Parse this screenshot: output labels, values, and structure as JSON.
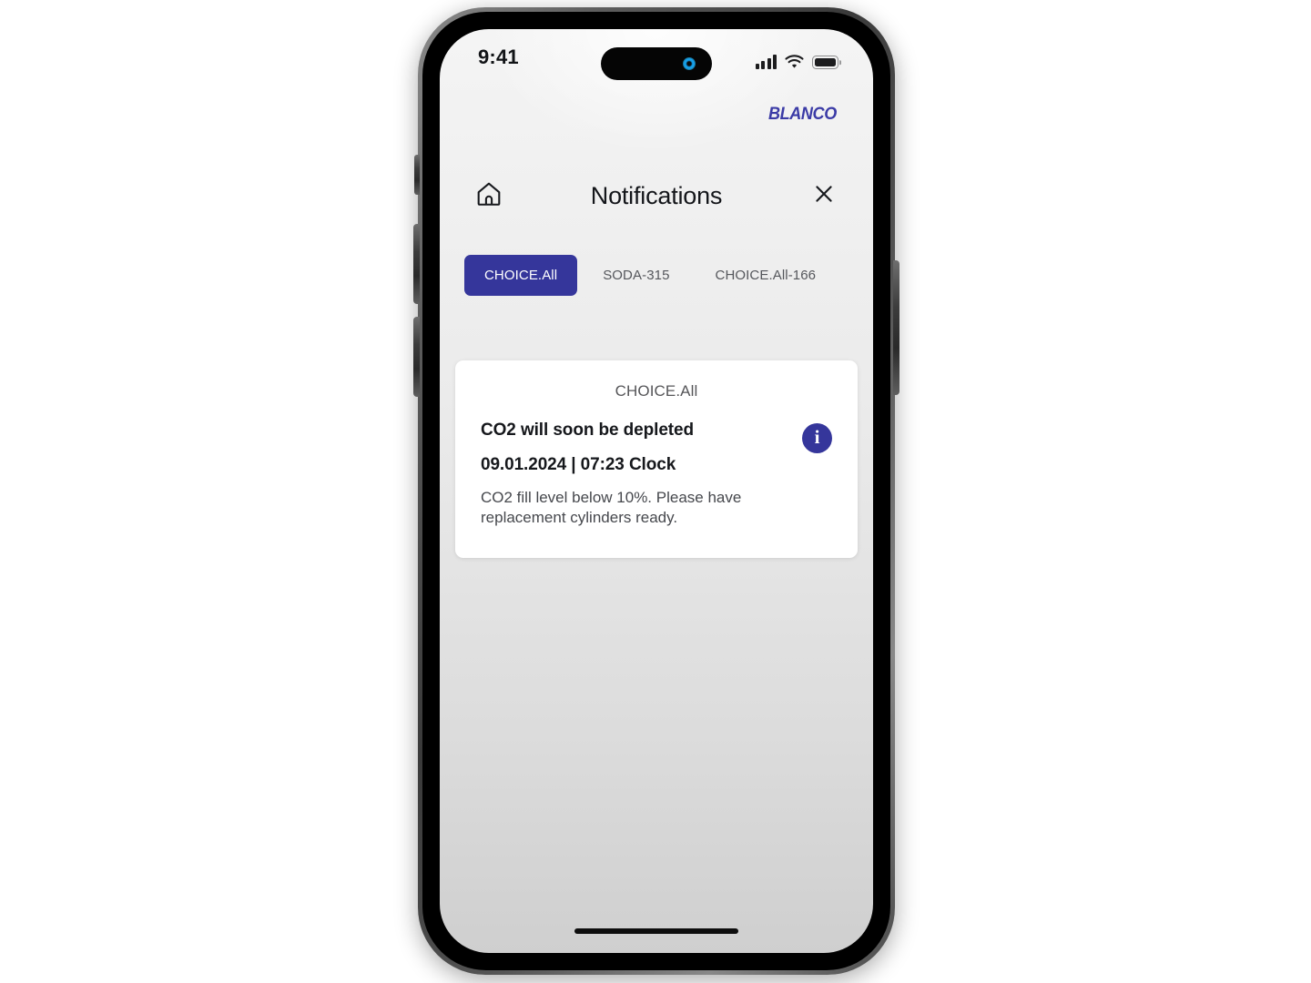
{
  "status_bar": {
    "time": "9:41",
    "signal_icon": "cellular-signal-icon",
    "wifi_icon": "wifi-icon",
    "battery_icon": "battery-icon"
  },
  "brand": {
    "logo_text": "BLANCO",
    "logo_color": "#3b3ba6"
  },
  "header": {
    "home_icon": "home-icon",
    "title": "Notifications",
    "close_icon": "close-icon"
  },
  "tabs": {
    "active_index": 0,
    "items": [
      {
        "label": "CHOICE.All",
        "active": true
      },
      {
        "label": "SODA-315",
        "active": false
      },
      {
        "label": "CHOICE.All-166",
        "active": false
      }
    ]
  },
  "notification": {
    "device": "CHOICE.All",
    "title": "CO2 will soon be depleted",
    "timestamp": "09.01.2024 | 07:23 Clock",
    "message": "CO2 fill level below 10%. Please have replacement cylinders ready.",
    "badge_icon": "info-icon",
    "badge_glyph": "i",
    "badge_color": "#35369b"
  },
  "colors": {
    "accent": "#35369b",
    "screen_background_top": "#f4f4f4",
    "screen_background_bottom": "#cfcfcf",
    "card_background": "#ffffff"
  },
  "system": {
    "home_indicator": "home-indicator"
  }
}
